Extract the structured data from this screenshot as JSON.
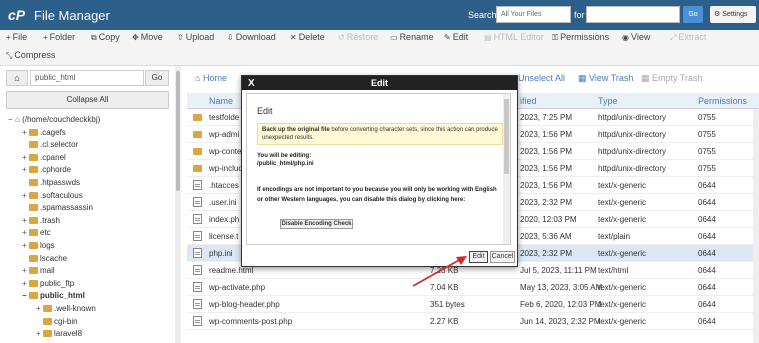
{
  "header": {
    "title": "File Manager",
    "search_label": "Search",
    "search_scope": "All Your Files",
    "for_label": "for",
    "search_value": "",
    "go_label": "Go",
    "settings_label": "Settings"
  },
  "toolbar": {
    "file": "File",
    "folder": "Folder",
    "copy": "Copy",
    "move": "Move",
    "upload": "Upload",
    "download": "Download",
    "delete": "Delete",
    "restore": "Restore",
    "rename": "Rename",
    "edit": "Edit",
    "html_editor": "HTML Editor",
    "permissions": "Permissions",
    "view": "View",
    "extract": "Extract",
    "compress": "Compress"
  },
  "left": {
    "path_value": "public_html",
    "go_label": "Go",
    "collapse_label": "Collapse All",
    "tree": [
      {
        "label": "(/home/couchdeckkbj)",
        "toggle": "−",
        "depth": 0,
        "bold": false,
        "home": true
      },
      {
        "label": ".cagefs",
        "toggle": "+",
        "depth": 1,
        "bold": false
      },
      {
        "label": ".cl.selector",
        "toggle": "",
        "depth": 1,
        "bold": false
      },
      {
        "label": ".cpanel",
        "toggle": "+",
        "depth": 1,
        "bold": false
      },
      {
        "label": ".cphorde",
        "toggle": "+",
        "depth": 1,
        "bold": false
      },
      {
        "label": ".htpasswds",
        "toggle": "",
        "depth": 1,
        "bold": false
      },
      {
        "label": ".softaculous",
        "toggle": "+",
        "depth": 1,
        "bold": false
      },
      {
        "label": ".spamassassin",
        "toggle": "",
        "depth": 1,
        "bold": false
      },
      {
        "label": ".trash",
        "toggle": "+",
        "depth": 1,
        "bold": false
      },
      {
        "label": "etc",
        "toggle": "+",
        "depth": 1,
        "bold": false
      },
      {
        "label": "logs",
        "toggle": "+",
        "depth": 1,
        "bold": false
      },
      {
        "label": "lscache",
        "toggle": "",
        "depth": 1,
        "bold": false
      },
      {
        "label": "mail",
        "toggle": "+",
        "depth": 1,
        "bold": false
      },
      {
        "label": "public_ftp",
        "toggle": "+",
        "depth": 1,
        "bold": false
      },
      {
        "label": "public_html",
        "toggle": "−",
        "depth": 1,
        "bold": true
      },
      {
        "label": ".well-known",
        "toggle": "+",
        "depth": 2,
        "bold": false
      },
      {
        "label": "cgi-bin",
        "toggle": "",
        "depth": 2,
        "bold": false
      },
      {
        "label": "laravel8",
        "toggle": "+",
        "depth": 2,
        "bold": false
      }
    ]
  },
  "right_toolbar": {
    "home": "Home",
    "unselect_all": "Unselect All",
    "view_trash": "View Trash",
    "empty_trash": "Empty Trash"
  },
  "table": {
    "headers": {
      "name": "Name",
      "size": "",
      "modified": "ified",
      "type": "Type",
      "permissions": "Permissions"
    },
    "rows": [
      {
        "kind": "folder",
        "name": "testfolde",
        "size": "",
        "modified": "2023, 7:25 PM",
        "type": "httpd/unix-directory",
        "perm": "0755",
        "hl": false
      },
      {
        "kind": "folder",
        "name": "wp-admi",
        "size": "",
        "modified": "2023, 1:56 PM",
        "type": "httpd/unix-directory",
        "perm": "0755",
        "hl": false
      },
      {
        "kind": "folder",
        "name": "wp-conte",
        "size": "",
        "modified": "2023, 1:56 PM",
        "type": "httpd/unix-directory",
        "perm": "0755",
        "hl": false
      },
      {
        "kind": "folder",
        "name": "wp-includ",
        "size": "",
        "modified": "2023, 1:56 PM",
        "type": "httpd/unix-directory",
        "perm": "0755",
        "hl": false
      },
      {
        "kind": "doc",
        "name": ".htacces",
        "size": "",
        "modified": "2023, 1:56 PM",
        "type": "text/x-generic",
        "perm": "0644",
        "hl": false
      },
      {
        "kind": "doc",
        "name": ".user.ini",
        "size": "",
        "modified": "2023, 2:32 PM",
        "type": "text/x-generic",
        "perm": "0644",
        "hl": false
      },
      {
        "kind": "doc",
        "name": "index.ph",
        "size": "",
        "modified": "2020, 12:03 PM",
        "type": "text/x-generic",
        "perm": "0644",
        "hl": false
      },
      {
        "kind": "doc",
        "name": "license.t",
        "size": "",
        "modified": "2023, 5:36 AM",
        "type": "text/plain",
        "perm": "0644",
        "hl": false
      },
      {
        "kind": "doc",
        "name": "php.ini",
        "size": "",
        "modified": "2023, 2:32 PM",
        "type": "text/x-generic",
        "perm": "0644",
        "hl": true
      },
      {
        "kind": "doc",
        "name": "readme.html",
        "size": "7.23 KB",
        "modified": "Jul 5, 2023, 11:11 PM",
        "type": "text/html",
        "perm": "0644",
        "hl": false
      },
      {
        "kind": "doc",
        "name": "wp-activate.php",
        "size": "7.04 KB",
        "modified": "May 13, 2023, 3:05 AM",
        "type": "text/x-generic",
        "perm": "0644",
        "hl": false
      },
      {
        "kind": "doc",
        "name": "wp-blog-header.php",
        "size": "351 bytes",
        "modified": "Feb 6, 2020, 12:03 PM",
        "type": "text/x-generic",
        "perm": "0644",
        "hl": false
      },
      {
        "kind": "doc",
        "name": "wp-comments-post.php",
        "size": "2.27 KB",
        "modified": "Jun 14, 2023, 2:32 PM",
        "type": "text/x-generic",
        "perm": "0644",
        "hl": false
      }
    ]
  },
  "modal": {
    "title": "Edit",
    "close": "X",
    "heading": "Edit",
    "warn_bold": "Back up the original file",
    "warn_rest": " before converting character sets, since this action can produce unexpected results.",
    "editing_label": "You will be editing:",
    "editing_path": "/public_html/php.ini",
    "encoding_text": "If encodings are not important to you because you will only be working with English or other Western languages, you can disable this dialog by clicking here:",
    "disable_button": "Disable Encoding Check",
    "edit_button": "Edit",
    "cancel_button": "Cancel"
  },
  "colors": {
    "header_bg": "#2d5f8b",
    "accent": "#4a7db7",
    "highlight_row": "#dbe8f3",
    "arrow": "#d62828"
  }
}
